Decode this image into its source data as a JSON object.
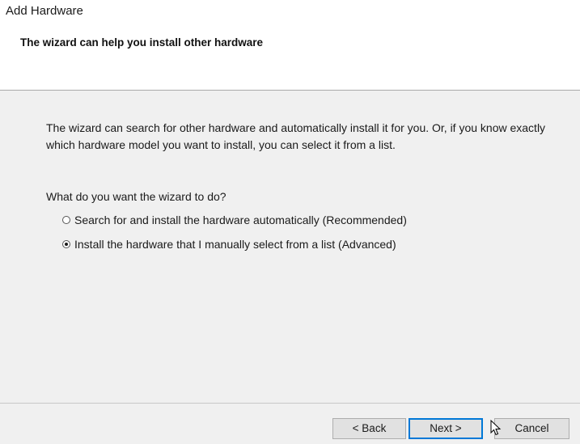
{
  "window": {
    "title": "Add Hardware"
  },
  "header": {
    "heading": "The wizard can help you install other hardware"
  },
  "content": {
    "description": "The wizard can search for other hardware and automatically install it for you. Or, if you know exactly which hardware model you want to install, you can select it from a list.",
    "question": "What do you want the wizard to do?",
    "options": [
      {
        "label": "Search for and install the hardware automatically (Recommended)",
        "selected": false
      },
      {
        "label": "Install the hardware that I manually select from a list (Advanced)",
        "selected": true
      }
    ]
  },
  "footer": {
    "back_label": "< Back",
    "next_label": "Next >",
    "cancel_label": "Cancel"
  },
  "colors": {
    "focus_border": "#0078d7",
    "button_face": "#e1e1e1",
    "dialog_bg": "#f0f0f0"
  }
}
